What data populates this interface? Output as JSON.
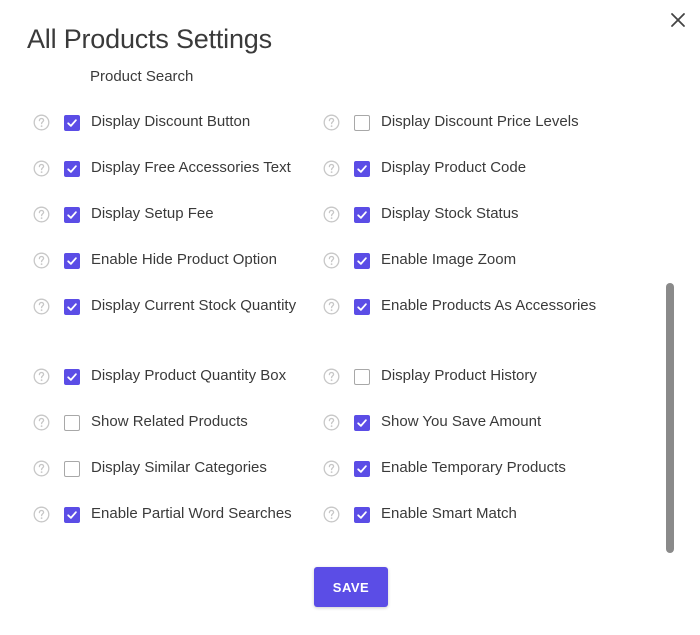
{
  "dialog": {
    "title": "All Products Settings",
    "section_label": "Product Search",
    "save_label": "SAVE",
    "accent_color": "#5b4de6"
  },
  "rows": [
    {
      "left": {
        "label": "Display Discount Button",
        "checked": true
      },
      "right": {
        "label": "Display Discount Price Levels",
        "checked": false
      }
    },
    {
      "left": {
        "label": "Display Free Accessories Text",
        "checked": true
      },
      "right": {
        "label": "Display Product Code",
        "checked": true
      }
    },
    {
      "left": {
        "label": "Display Setup Fee",
        "checked": true
      },
      "right": {
        "label": "Display Stock Status",
        "checked": true
      }
    },
    {
      "left": {
        "label": "Enable Hide Product Option",
        "checked": true
      },
      "right": {
        "label": "Enable Image Zoom",
        "checked": true
      }
    },
    {
      "left": {
        "label": "Display Current Stock Quantity",
        "checked": true
      },
      "right": {
        "label": "Enable Products As Accessories",
        "checked": true
      }
    },
    {
      "left": {
        "label": "Display Product Quantity Box",
        "checked": true
      },
      "right": {
        "label": "Display Product History",
        "checked": false
      }
    },
    {
      "left": {
        "label": "Show Related Products",
        "checked": false
      },
      "right": {
        "label": "Show You Save Amount",
        "checked": true
      }
    },
    {
      "left": {
        "label": "Display Similar Categories",
        "checked": false
      },
      "right": {
        "label": "Enable Temporary Products",
        "checked": true
      }
    },
    {
      "left": {
        "label": "Enable Partial Word Searches",
        "checked": true
      },
      "right": {
        "label": "Enable Smart Match",
        "checked": true
      }
    }
  ],
  "icons": {
    "close": "close-icon",
    "help": "help-circle-icon",
    "check": "checkmark-icon"
  }
}
